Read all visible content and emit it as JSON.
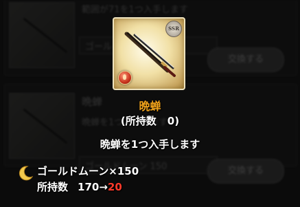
{
  "background": {
    "top_header": "範囲が71を1つ入手します",
    "card1_field": "ゴールドムーン×150",
    "card1_button": "交換する",
    "card2_title": "晩蝉",
    "card2_desc": "晩蝉を1つ入手します",
    "card2_field": "ゴールドムーン 150",
    "card2_button": "交換する"
  },
  "item": {
    "rarity_badge": "SSR",
    "element_icon": "fire-element-icon",
    "image_icon": "katana-sword-icon",
    "name": "晩蝉",
    "owned_label": "(所持数",
    "owned_value": "0)",
    "description": "晩蝉を1つ入手します"
  },
  "cost": {
    "currency_icon": "gold-moon-icon",
    "label": "ゴールドムーン×150",
    "count_label": "所持数",
    "count_before": "170→",
    "count_after": "20"
  },
  "colors": {
    "item_name": "#f0a21b",
    "count_after": "#ff3a2a",
    "moon": "#f2c94c"
  }
}
